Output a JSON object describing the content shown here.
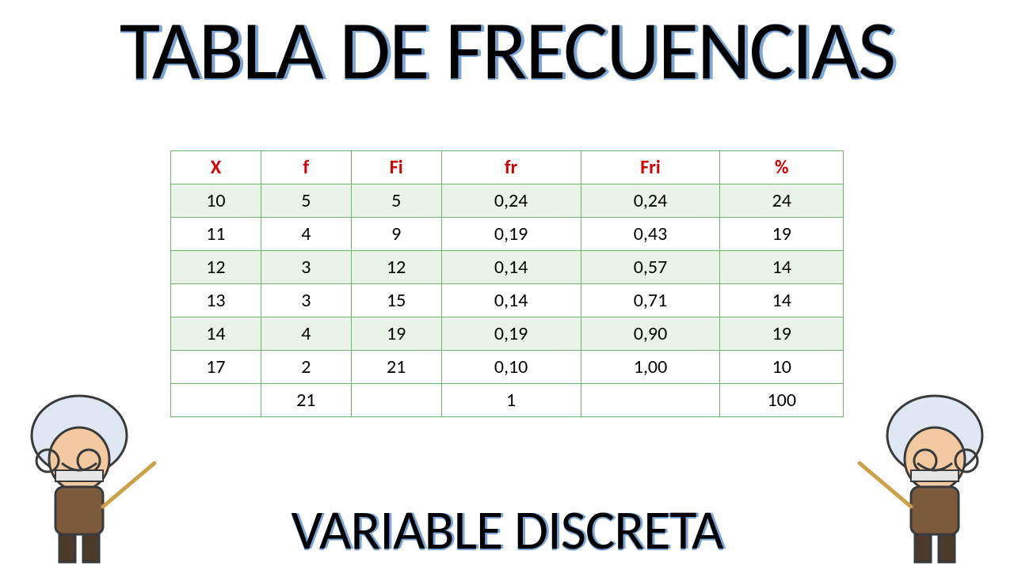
{
  "title": "TABLA DE FRECUENCIAS",
  "subtitle": "VARIABLE DISCRETA",
  "headers": [
    "X",
    "f",
    "Fi",
    "fr",
    "Fri",
    "%"
  ],
  "rows": [
    {
      "X": "10",
      "f": "5",
      "Fi": "5",
      "fr": "0,24",
      "Fri": "0,24",
      "pct": "24",
      "stripe": true
    },
    {
      "X": "11",
      "f": "4",
      "Fi": "9",
      "fr": "0,19",
      "Fri": "0,43",
      "pct": "19",
      "stripe": false
    },
    {
      "X": "12",
      "f": "3",
      "Fi": "12",
      "fr": "0,14",
      "Fri": "0,57",
      "pct": "14",
      "stripe": true
    },
    {
      "X": "13",
      "f": "3",
      "Fi": "15",
      "fr": "0,14",
      "Fri": "0,71",
      "pct": "14",
      "stripe": false
    },
    {
      "X": "14",
      "f": "4",
      "Fi": "19",
      "fr": "0,19",
      "Fri": "0,90",
      "pct": "19",
      "stripe": true
    },
    {
      "X": "17",
      "f": "2",
      "Fi": "21",
      "fr": "0,10",
      "Fri": "1,00",
      "pct": "10",
      "stripe": false
    }
  ],
  "totals": {
    "X": "",
    "f": "21",
    "Fi": "",
    "fr": "1",
    "Fri": "",
    "pct": "100"
  },
  "chart_data": {
    "type": "table",
    "title": "TABLA DE FRECUENCIAS",
    "subtitle": "VARIABLE DISCRETA",
    "columns": [
      "X",
      "f",
      "Fi",
      "fr",
      "Fri",
      "%"
    ],
    "data": [
      [
        10,
        5,
        5,
        0.24,
        0.24,
        24
      ],
      [
        11,
        4,
        9,
        0.19,
        0.43,
        19
      ],
      [
        12,
        3,
        12,
        0.14,
        0.57,
        14
      ],
      [
        13,
        3,
        15,
        0.14,
        0.71,
        14
      ],
      [
        14,
        4,
        19,
        0.19,
        0.9,
        19
      ],
      [
        17,
        2,
        21,
        0.1,
        1.0,
        10
      ]
    ],
    "totals": {
      "f": 21,
      "fr": 1,
      "%": 100
    }
  }
}
